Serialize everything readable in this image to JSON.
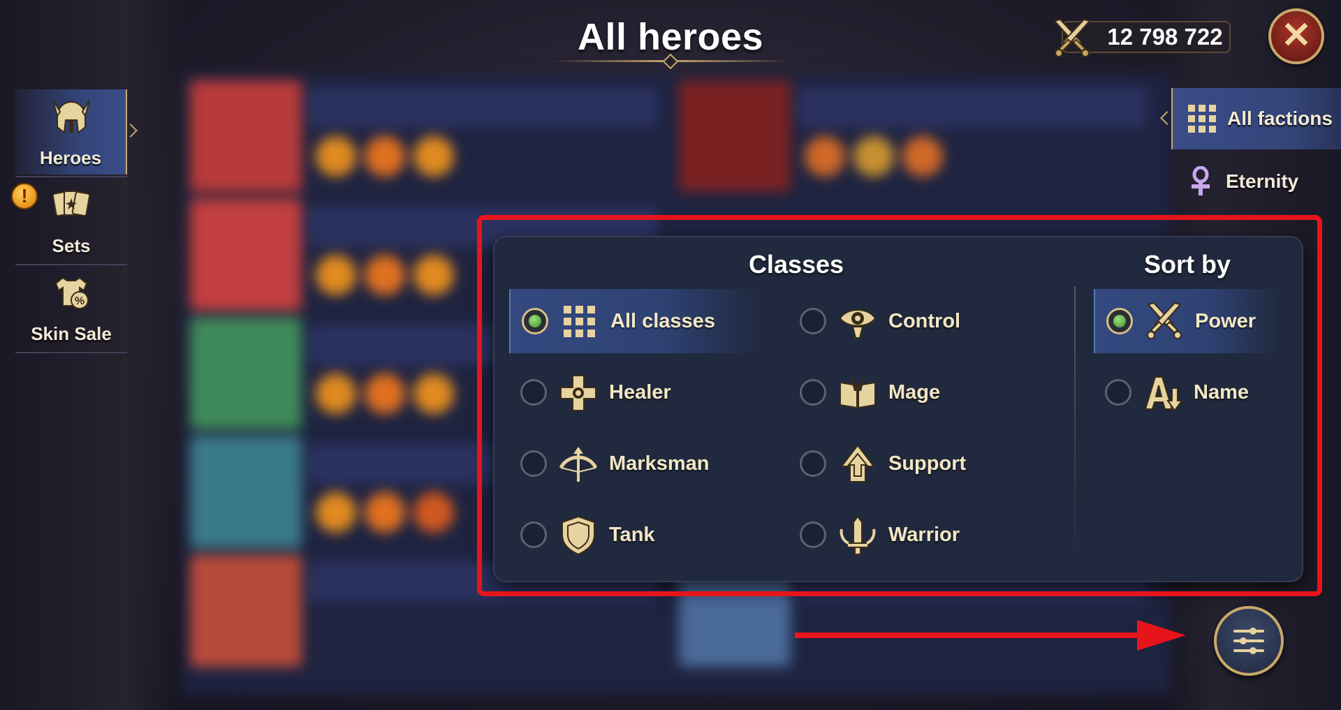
{
  "header": {
    "title": "All heroes",
    "power_value": "12 798 722"
  },
  "sidebar_left": {
    "items": [
      {
        "label": "Heroes",
        "icon": "helmet-icon",
        "active": true
      },
      {
        "label": "Sets",
        "icon": "cards-icon",
        "active": false,
        "badge": "!"
      },
      {
        "label": "Skin Sale",
        "icon": "shirt-sale-icon",
        "active": false
      }
    ]
  },
  "factions": {
    "items": [
      {
        "label": "All factions",
        "icon": "grid-icon",
        "active": true
      },
      {
        "label": "Eternity",
        "icon": "ankh-icon",
        "active": false
      }
    ]
  },
  "filter_panel": {
    "classes_title": "Classes",
    "sort_title": "Sort by",
    "classes": [
      {
        "label": "All classes",
        "icon": "grid-icon",
        "selected": true
      },
      {
        "label": "Control",
        "icon": "eye-icon",
        "selected": false
      },
      {
        "label": "Healer",
        "icon": "healer-cross-icon",
        "selected": false
      },
      {
        "label": "Mage",
        "icon": "spellbook-icon",
        "selected": false
      },
      {
        "label": "Marksman",
        "icon": "bow-icon",
        "selected": false
      },
      {
        "label": "Support",
        "icon": "arrow-up-icon",
        "selected": false
      },
      {
        "label": "Tank",
        "icon": "shield-icon",
        "selected": false
      },
      {
        "label": "Warrior",
        "icon": "sword-icon",
        "selected": false
      }
    ],
    "sort": [
      {
        "label": "Power",
        "icon": "crossed-swords-icon",
        "selected": true
      },
      {
        "label": "Name",
        "icon": "alpha-sort-icon",
        "selected": false
      }
    ]
  },
  "colors": {
    "accent_gold": "#c8aa6e",
    "highlight_red": "#e8141c",
    "panel_bg": "#20293d",
    "selected_row": "#34497f",
    "radio_on": "#5fb843"
  }
}
